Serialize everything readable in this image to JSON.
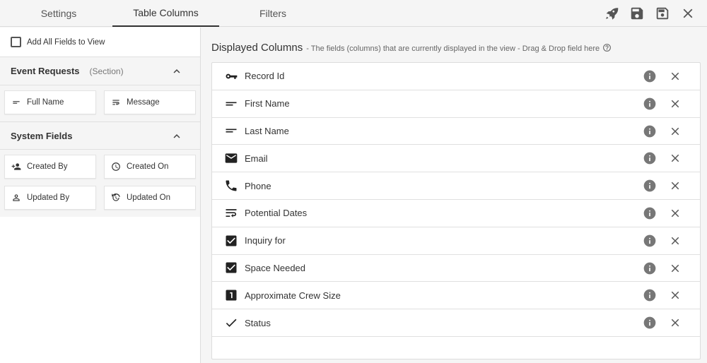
{
  "tabs": [
    {
      "label": "Settings",
      "active": false
    },
    {
      "label": "Table Columns",
      "active": true
    },
    {
      "label": "Filters",
      "active": false
    }
  ],
  "actions": [
    "rocket-icon",
    "save-icon",
    "save-as-icon",
    "close-icon"
  ],
  "left": {
    "add_all_label": "Add All Fields to View",
    "sections": [
      {
        "title": "Event Requests",
        "subtitle": "(Section)",
        "fields": [
          {
            "label": "Full Name",
            "icon": "short-text-icon"
          },
          {
            "label": "Message",
            "icon": "long-text-icon"
          }
        ]
      },
      {
        "title": "System Fields",
        "subtitle": "",
        "fields": [
          {
            "label": "Created By",
            "icon": "person-add-icon"
          },
          {
            "label": "Created On",
            "icon": "clock-icon"
          },
          {
            "label": "Updated By",
            "icon": "person-icon"
          },
          {
            "label": "Updated On",
            "icon": "refresh-clock-icon"
          }
        ]
      }
    ]
  },
  "right": {
    "title": "Displayed Columns",
    "description": "- The fields (columns) that are currently displayed in the view - Drag & Drop field here",
    "columns": [
      {
        "label": "Record Id",
        "icon": "key-icon"
      },
      {
        "label": "First Name",
        "icon": "short-text-icon"
      },
      {
        "label": "Last Name",
        "icon": "short-text-icon"
      },
      {
        "label": "Email",
        "icon": "email-icon"
      },
      {
        "label": "Phone",
        "icon": "phone-icon"
      },
      {
        "label": "Potential Dates",
        "icon": "long-text-icon"
      },
      {
        "label": "Inquiry for",
        "icon": "checkbox-icon"
      },
      {
        "label": "Space Needed",
        "icon": "checkbox-icon"
      },
      {
        "label": "Approximate Crew Size",
        "icon": "number-icon"
      },
      {
        "label": "Status",
        "icon": "check-icon"
      }
    ]
  }
}
